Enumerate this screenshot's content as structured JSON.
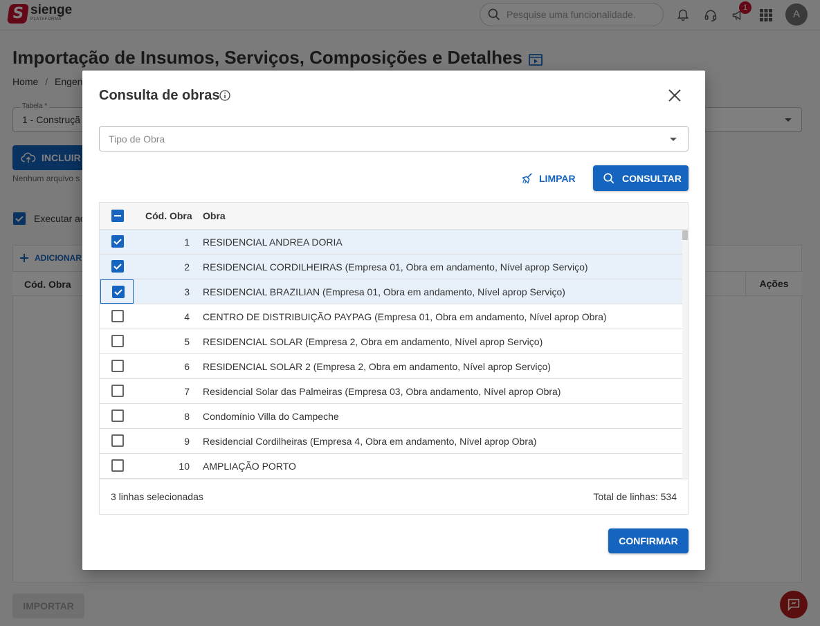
{
  "topbar": {
    "logo_mark": "S",
    "logo_name": "sienge",
    "logo_sub": "PLATAFORMA",
    "search_placeholder": "Pesquise uma funcionalidade.",
    "notifications_badge": "1",
    "avatar_initial": "A",
    "icons": [
      "search-icon",
      "bell-icon",
      "headset-icon",
      "megaphone-icon",
      "apps-grid-icon"
    ]
  },
  "page": {
    "title": "Importação de Insumos, Serviços, Composições e Detalhes",
    "breadcrumb_home": "Home",
    "breadcrumb_sep": "/",
    "breadcrumb_next": "Engenh",
    "tabela_label": "Tabela *",
    "tabela_value": "1 - Construçã",
    "incluir_label": "INCLUIR A",
    "no_file_text": "Nenhum arquivo s",
    "executar_label": "Executar ac",
    "adicionar_label": "ADICIONAR",
    "col_cod_obra": "Cód. Obra",
    "col_acoes": "Ações",
    "importar_label": "IMPORTAR"
  },
  "dialog": {
    "title": "Consulta de obras",
    "tipo_obra_placeholder": "Tipo de Obra",
    "limpar_label": "LIMPAR",
    "consultar_label": "CONSULTAR",
    "columns": {
      "cod": "Cód. Obra",
      "obra": "Obra"
    },
    "rows": [
      {
        "cod": "1",
        "obra": "RESIDENCIAL ANDREA DORIA",
        "checked": true
      },
      {
        "cod": "2",
        "obra": "RESIDENCIAL CORDILHEIRAS (Empresa 01, Obra em andamento, Nível aprop Serviço)",
        "checked": true
      },
      {
        "cod": "3",
        "obra": "RESIDENCIAL BRAZILIAN (Empresa 01, Obra em andamento, Nível aprop Serviço)",
        "checked": true
      },
      {
        "cod": "4",
        "obra": "CENTRO DE DISTRIBUIÇÃO PAYPAG (Empresa 01, Obra em andamento, Nível aprop Obra)",
        "checked": false
      },
      {
        "cod": "5",
        "obra": "RESIDENCIAL SOLAR (Empresa 2, Obra em andamento, Nível aprop Serviço)",
        "checked": false
      },
      {
        "cod": "6",
        "obra": "RESIDENCIAL SOLAR 2 (Empresa 2, Obra em andamento, Nível aprop Serviço)",
        "checked": false
      },
      {
        "cod": "7",
        "obra": "Residencial Solar das Palmeiras (Empresa 03, Obra andamento, Nível aprop Obra)",
        "checked": false
      },
      {
        "cod": "8",
        "obra": "Condomínio Villa do Campeche",
        "checked": false
      },
      {
        "cod": "9",
        "obra": "Residencial Cordilheiras (Empresa 4, Obra em andamento, Nível aprop Obra)",
        "checked": false
      },
      {
        "cod": "10",
        "obra": "AMPLIAÇÃO PORTO",
        "checked": false
      }
    ],
    "selected_text": "3 linhas selecionadas",
    "total_text": "Total de linhas: 534",
    "confirmar_label": "CONFIRMAR"
  },
  "colors": {
    "primary": "#1565c0",
    "brand_red": "#c8102e",
    "selected_row": "#e8f0fa"
  }
}
